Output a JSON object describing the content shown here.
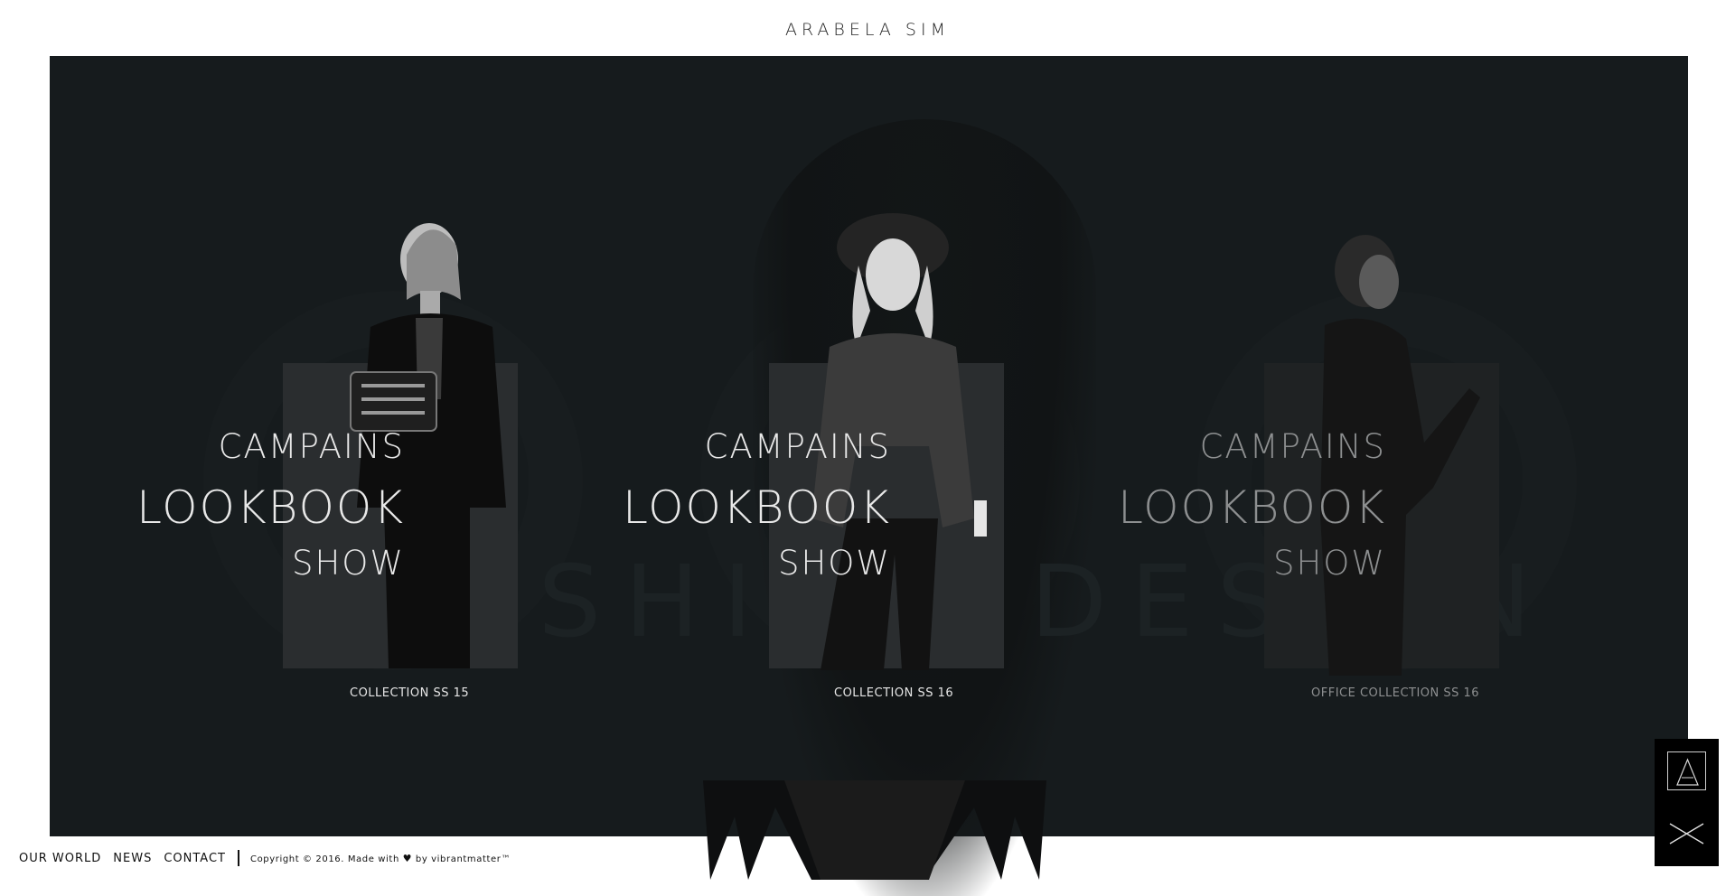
{
  "header": {
    "brand": "ARABELA SIM"
  },
  "background": {
    "watermark": "FASHION DESIGN"
  },
  "collections": [
    {
      "menu": [
        "CAMPAINS",
        "LOOKBOOK",
        "SHOW"
      ],
      "caption": "COLLECTION SS 15"
    },
    {
      "menu": [
        "CAMPAINS",
        "LOOKBOOK",
        "SHOW"
      ],
      "caption": "COLLECTION SS 16"
    },
    {
      "menu": [
        "CAMPAINS",
        "LOOKBOOK",
        "SHOW"
      ],
      "caption": "OFFICE COLLECTION SS 16"
    }
  ],
  "footer": {
    "nav": [
      "OUR WORLD",
      "NEWS",
      "CONTACT"
    ],
    "copyright_prefix": "Copyright © 2016. Made with",
    "copyright_suffix": "by vibrantmatter™"
  },
  "icons": {
    "heart": "heart-icon",
    "logo": "logo-mark-icon",
    "close": "close-icon"
  },
  "colors": {
    "stage": "#161b1d",
    "text_light": "#e8e8e8",
    "text_dim": "#8d8f90"
  }
}
